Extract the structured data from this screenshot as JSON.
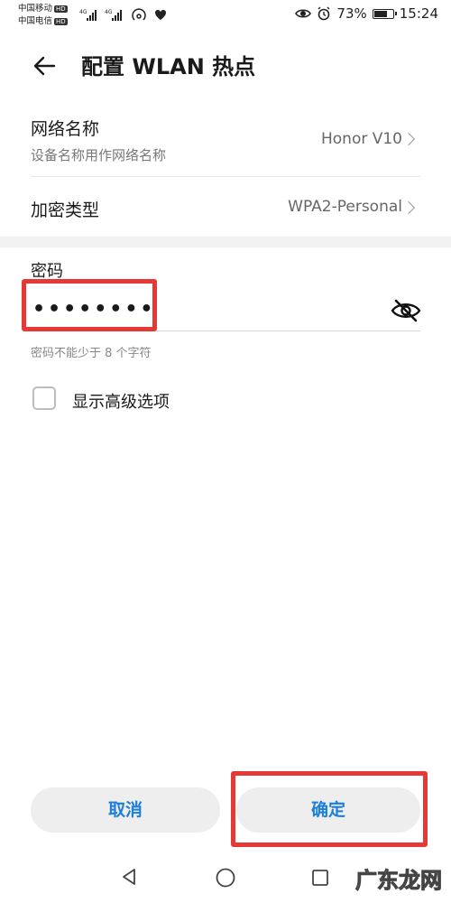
{
  "status_bar": {
    "carrier1": "中国移动",
    "carrier2": "中国电信",
    "hd": "HD",
    "net_badge": "4G",
    "battery_text": "73%",
    "battery_level": 0.73,
    "time": "15:24"
  },
  "header": {
    "title": "配置 WLAN 热点"
  },
  "network_name": {
    "label": "网络名称",
    "sublabel": "设备名称用作网络名称",
    "value": "Honor V10"
  },
  "encryption": {
    "label": "加密类型",
    "value": "WPA2-Personal"
  },
  "password": {
    "label": "密码",
    "value_masked": "••••••••",
    "hint": "密码不能少于 8 个字符"
  },
  "advanced": {
    "label": "显示高级选项"
  },
  "buttons": {
    "cancel": "取消",
    "confirm": "确定"
  },
  "watermark": "广东龙网",
  "colors": {
    "accent": "#1e7fd6",
    "highlight": "#e53935"
  }
}
